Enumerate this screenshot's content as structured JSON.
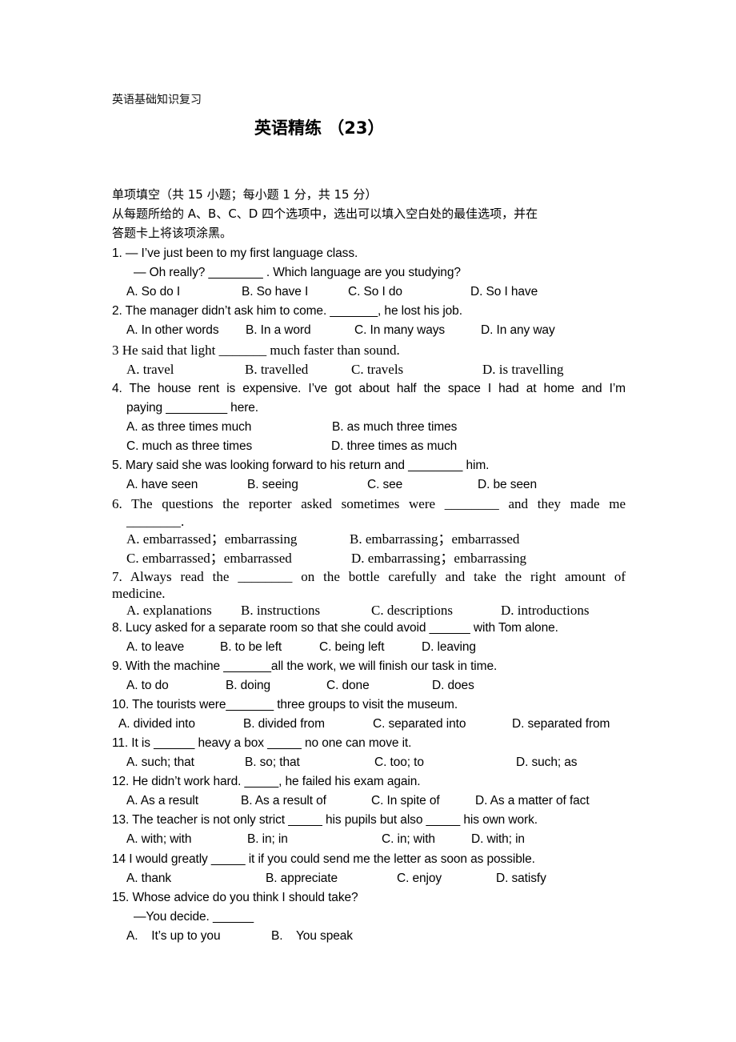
{
  "header": "英语基础知识复习",
  "title": "英语精练 （23）",
  "section": {
    "heading": "单项填空（共 15 小题；每小题 1 分，共 15 分）",
    "instruction_line1": "从每题所给的 A、B、C、D 四个选项中，选出可以填入空白处的最佳选项，并在",
    "instruction_line2": "答题卡上将该项涂黑。"
  },
  "questions": [
    {
      "number": "1",
      "lines": [
        "1. — I’ve just been to my first language class.",
        "— Oh really? ________ . Which language are you studying?"
      ],
      "options": [
        "A. So do I",
        "B. So have I",
        "C. So I do",
        "D. So I have"
      ]
    },
    {
      "number": "2",
      "lines": [
        "2. The manager didn’t ask him to come. _______, he lost his job."
      ],
      "options": [
        "A. In other words",
        "B. In a word",
        "C. In many ways",
        "D. In any way"
      ]
    },
    {
      "number": "3",
      "lines": [
        "3 He said that light _______ much faster than sound."
      ],
      "options": [
        "A. travel",
        "B. travelled",
        "C. travels",
        "D. is travelling"
      ]
    },
    {
      "number": "4",
      "lines": [
        "4. The house rent is expensive. I’ve got about half the space I had at home and I’m",
        "paying _________ here."
      ],
      "options": [
        "A. as three times much",
        "B. as much three times",
        "C. much as three times",
        "D. three times as much"
      ]
    },
    {
      "number": "5",
      "lines": [
        "5. Mary said she was looking forward to his return and ________ him."
      ],
      "options": [
        "A. have seen",
        "B. seeing",
        "C. see",
        "D. be seen"
      ]
    },
    {
      "number": "6",
      "lines": [
        "6. The questions the reporter asked sometimes were ________ and they made me",
        "________."
      ],
      "options": [
        "A. embarrassed；embarrassing",
        "B. embarrassing；embarrassed",
        "C. embarrassed；embarrassed",
        "D. embarrassing；embarrassing"
      ]
    },
    {
      "number": "7",
      "lines": [
        "7. Always read the ________ on the bottle carefully and take the right amount of",
        "medicine."
      ],
      "options": [
        "A. explanations",
        "B. instructions",
        "C. descriptions",
        "D. introductions"
      ]
    },
    {
      "number": "8",
      "lines": [
        "8. Lucy asked for a separate room so that she could avoid ______ with Tom alone."
      ],
      "options": [
        "A. to leave",
        "B. to be left",
        "C. being left",
        "D. leaving"
      ]
    },
    {
      "number": "9",
      "lines": [
        "9. With the machine _______all the work, we will finish our task in time."
      ],
      "options": [
        "A. to do",
        "B. doing",
        "C. done",
        "D. does"
      ]
    },
    {
      "number": "10",
      "lines": [
        "10. The tourists were_______ three groups to visit the museum."
      ],
      "options": [
        "A. divided into",
        "B. divided from",
        "C. separated into",
        "D. separated from"
      ]
    },
    {
      "number": "11",
      "lines": [
        "11. It is ______ heavy a box _____ no one can move it."
      ],
      "options": [
        "A. such; that",
        "B. so; that",
        "C. too; to",
        "D. such; as"
      ]
    },
    {
      "number": "12",
      "lines": [
        "12. He didn’t work hard. _____, he failed his exam again."
      ],
      "options": [
        "A. As a result",
        "B. As a result of",
        "C. In spite of",
        "D. As a matter of fact"
      ]
    },
    {
      "number": "13",
      "lines": [
        "13. The teacher is not only strict _____ his pupils but also _____ his own work."
      ],
      "options": [
        "A. with; with",
        "B. in; in",
        "C. in; with",
        "D. with; in"
      ]
    },
    {
      "number": "14",
      "lines": [
        "14 I would greatly _____ it if you could send me the letter as soon as possible."
      ],
      "options": [
        "A. thank",
        "B. appreciate",
        "C. enjoy",
        "D. satisfy"
      ]
    },
    {
      "number": "15",
      "lines": [
        "15. Whose advice do you think I should take?",
        "—You decide. ______"
      ],
      "options": [
        "A.    It’s up to you",
        "B.    You speak"
      ]
    }
  ]
}
